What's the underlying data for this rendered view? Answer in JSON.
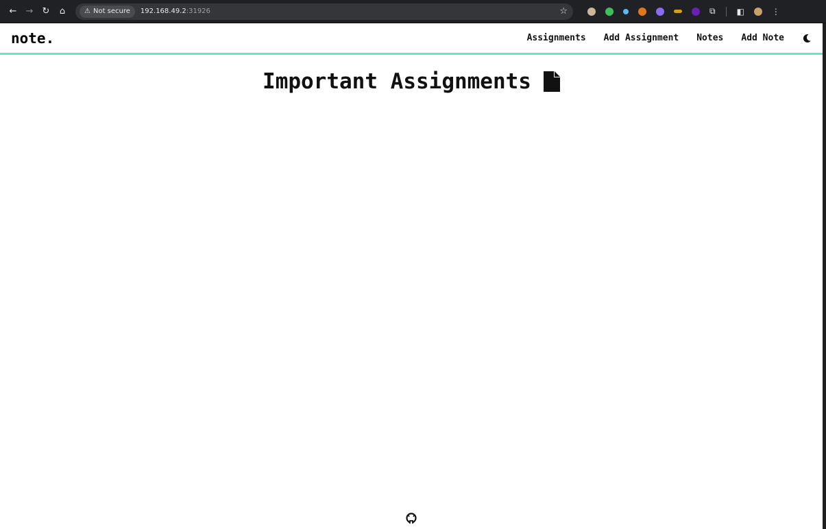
{
  "browser": {
    "security_label": "Not secure",
    "url_host": "192.168.49.2",
    "url_port": ":31926",
    "icons": [
      "back-icon",
      "forward-icon",
      "reload-icon",
      "home-icon",
      "warning-icon",
      "star-icon",
      "extensions-icon",
      "sidebar-icon",
      "profile-icon",
      "menu-icon"
    ]
  },
  "app": {
    "brand": "note.",
    "nav": {
      "assignments": "Assignments",
      "add_assignment": "Add Assignment",
      "notes": "Notes",
      "add_note": "Add Note"
    },
    "theme_toggle_icon": "moon-icon",
    "accent_color": "#5ee8c8"
  },
  "main": {
    "title": "Important Assignments",
    "title_icon": "document-icon"
  },
  "footer": {
    "icon": "github-icon"
  }
}
